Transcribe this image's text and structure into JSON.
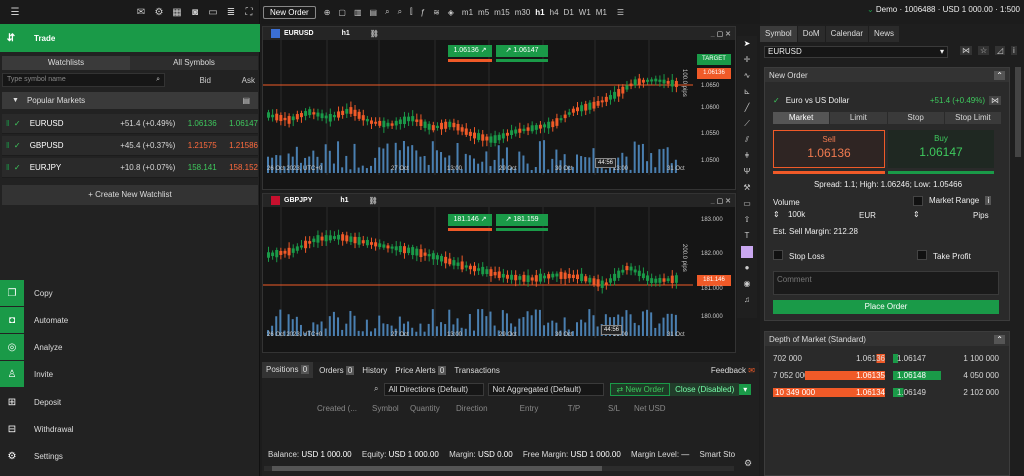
{
  "left": {
    "trade_label": "Trade",
    "tabs": [
      "Watchlists",
      "All Symbols"
    ],
    "search_placeholder": "Type symbol name",
    "bid": "Bid",
    "ask": "Ask",
    "popular": "Popular Markets",
    "rows": [
      {
        "sym": "EURUSD",
        "chg": "+51.4 (+0.49%)",
        "bid": "1.06136",
        "ask": "1.06147"
      },
      {
        "sym": "GBPUSD",
        "chg": "+45.4 (+0.37%)",
        "bid": "1.21575",
        "ask": "1.21586"
      },
      {
        "sym": "EURJPY",
        "chg": "+10.8 (+0.07%)",
        "bid": "158.141",
        "ask": "158.152"
      }
    ],
    "create": "+ Create New Watchlist",
    "menu": [
      "Copy",
      "Automate",
      "Analyze",
      "Invite",
      "Deposit",
      "Withdrawal",
      "Settings"
    ]
  },
  "toolbar": {
    "new_order": "New Order",
    "tfs": [
      "m1",
      "m5",
      "m15",
      "m30",
      "h1",
      "h4",
      "D1",
      "W1",
      "M1"
    ]
  },
  "account": {
    "text": "Demo · 1006488 · USD 1 000.00 · 1:500"
  },
  "chart1": {
    "symbol": "EURUSD",
    "tf": "h1",
    "sell": "1.06136",
    "buy": "1.06147",
    "target": "TARGET",
    "price": "1.06136",
    "yticks": [
      "1.0650",
      "1.0600",
      "1.0550",
      "1.0500"
    ],
    "pips": "100.0 pips",
    "xticks": [
      "26 Oct 2023, UTC+0",
      "27 Oct",
      "13:00",
      "29 Oct",
      "30 Oct",
      "13:00",
      "31 Oct"
    ],
    "timer": "44:56"
  },
  "chart2": {
    "symbol": "GBPJPY",
    "tf": "h1",
    "sell": "181.146",
    "buy": "181.159",
    "price": "181.146",
    "yticks": [
      "183.000",
      "182.000",
      "181.000",
      "180.000"
    ],
    "pips": "200.0 pips",
    "xticks": [
      "26 Oct 2023, UTC+0",
      "27 Oct",
      "13:00",
      "29 Oct",
      "30 Oct",
      "13:00",
      "31 Oct"
    ],
    "timer": "44:56"
  },
  "bottom": {
    "tabs": [
      "Positions",
      "Orders",
      "History",
      "Price Alerts",
      "Transactions"
    ],
    "counts": [
      "0",
      "0",
      "",
      "0",
      ""
    ],
    "feedback": "Feedback",
    "filter1": "All Directions (Default)",
    "filter2": "Not Aggregated (Default)",
    "new_order": "New Order",
    "close": "Close (Disabled)",
    "cols": [
      "Created (...",
      "Symbol",
      "Quantity",
      "Direction",
      "Entry",
      "T/P",
      "S/L",
      "Net USD"
    ],
    "status": [
      "Balance:",
      "USD 1 000.00",
      "Equity:",
      "USD 1 000.00",
      "Margin:",
      "USD 0.00",
      "Free Margin:",
      "USD 1 000.00",
      "Margin Level:",
      "—",
      "Smart Sto"
    ]
  },
  "right": {
    "tabs": [
      "Symbol",
      "DoM",
      "Calendar",
      "News"
    ],
    "symbol": "EURUSD",
    "new_order": "New Order",
    "pair": "Euro vs US Dollar",
    "pair_chg": "+51.4 (+0.49%)",
    "otabs": [
      "Market",
      "Limit",
      "Stop",
      "Stop Limit"
    ],
    "sell_label": "Sell",
    "sell_price": "1.06136",
    "buy_label": "Buy",
    "buy_price": "1.06147",
    "spread": "Spread: 1.1; High: 1.06246; Low: 1.05466",
    "volume": "Volume",
    "vol_value": "100k",
    "ccy": "EUR",
    "market_range": "Market Range",
    "pips": "Pips",
    "margin": "Est. Sell Margin: 212.28",
    "stop_loss": "Stop Loss",
    "take_profit": "Take Profit",
    "comment": "Comment",
    "place": "Place Order",
    "dom_title": "Depth of Market (Standard)",
    "dom": [
      {
        "bvol": "702 000",
        "bid": "1.06136",
        "ask": "1.06147",
        "avol": "1 100 000"
      },
      {
        "bvol": "7 052 000",
        "bid": "1.06135",
        "ask": "1.06148",
        "avol": "4 050 000"
      },
      {
        "bvol": "10 349 000",
        "bid": "1.06134",
        "ask": "1.06149",
        "avol": "2 102 000"
      }
    ]
  },
  "colors": {
    "green": "#1a9a48",
    "red": "#f05a28",
    "bg": "#1c1c1c"
  }
}
